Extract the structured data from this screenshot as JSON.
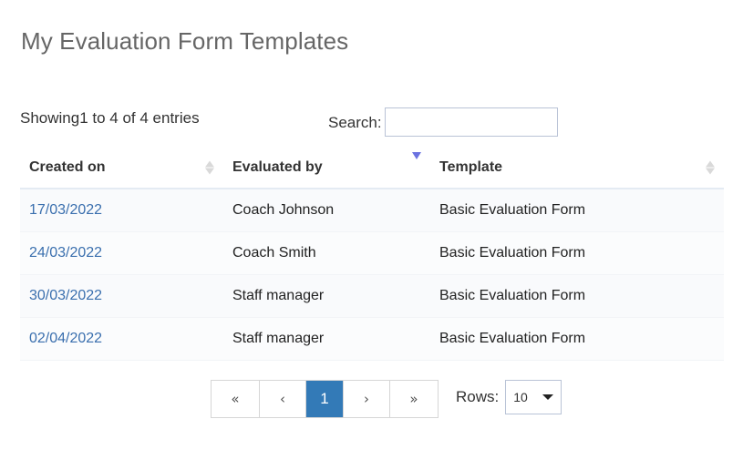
{
  "page": {
    "title": "My Evaluation Form Templates"
  },
  "table_info": "Showing1 to 4 of 4 entries",
  "search": {
    "label": "Search:",
    "value": "",
    "placeholder": ""
  },
  "table": {
    "columns": [
      {
        "label": "Created on",
        "sort": "none"
      },
      {
        "label": "Evaluated by",
        "sort": "descending"
      },
      {
        "label": "Template",
        "sort": "none"
      }
    ],
    "rows": [
      {
        "created_on": "17/03/2022",
        "evaluated_by": "Coach Johnson",
        "template": "Basic Evaluation Form"
      },
      {
        "created_on": "24/03/2022",
        "evaluated_by": "Coach Smith",
        "template": "Basic Evaluation Form"
      },
      {
        "created_on": "30/03/2022",
        "evaluated_by": "Staff manager",
        "template": "Basic Evaluation Form"
      },
      {
        "created_on": "02/04/2022",
        "evaluated_by": "Staff manager",
        "template": "Basic Evaluation Form"
      }
    ]
  },
  "pagination": {
    "first": "«",
    "prev": "‹",
    "current_page": "1",
    "next": "›",
    "last": "»",
    "rows_label": "Rows:",
    "rows_value": "10"
  },
  "colors": {
    "accent": "#337ab7",
    "link": "#3a6fae",
    "sort_active": "#6b72e0"
  }
}
